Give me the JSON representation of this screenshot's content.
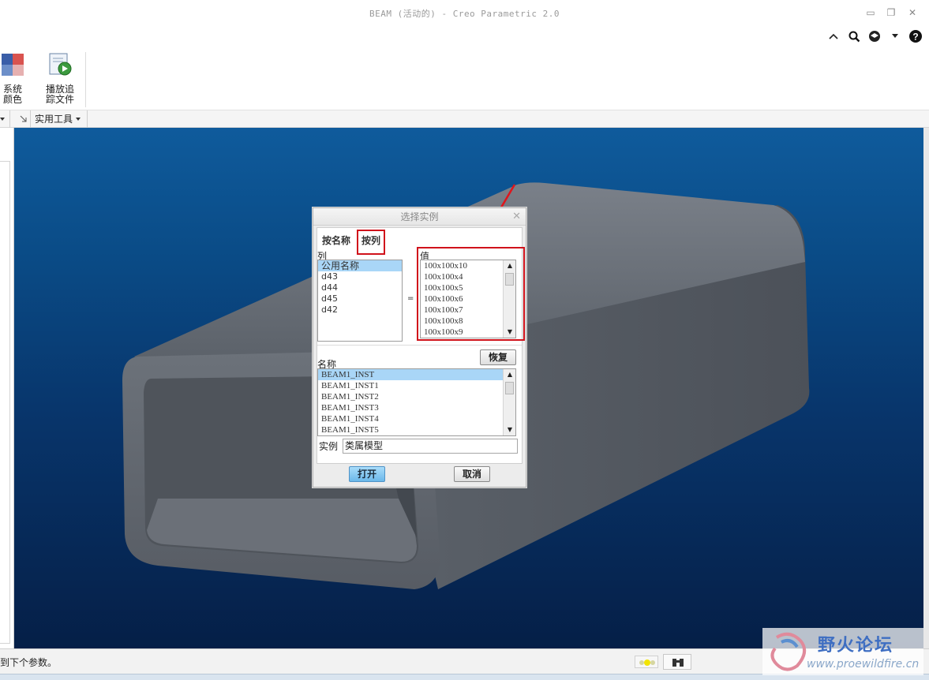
{
  "window": {
    "title": "BEAM (活动的) - Creo Parametric 2.0",
    "minimize": "▭",
    "restore": "❐",
    "close": "✕"
  },
  "quick_access": {
    "icons": [
      "collapse-ribbon-icon",
      "search-icon",
      "help-center-icon",
      "dropdown-icon",
      "help-icon"
    ]
  },
  "ribbon": {
    "buttons": [
      {
        "label": "系统\n颜色",
        "icon": "system-colors-icon"
      },
      {
        "label": "播放追\n踪文件",
        "icon": "play-trail-file-icon"
      }
    ],
    "group_label": "实用工具"
  },
  "dialog": {
    "title": "选择实例",
    "tabs": [
      {
        "label": "按名称"
      },
      {
        "label": "按列"
      }
    ],
    "columns_label": "列",
    "columns": [
      "公用名称",
      "d43",
      "d44",
      "d45",
      "d42"
    ],
    "equals": "=",
    "values_label": "值",
    "values": [
      "100x100x10",
      "100x100x4",
      "100x100x5",
      "100x100x6",
      "100x100x7",
      "100x100x8",
      "100x100x9"
    ],
    "restore_label": "恢复",
    "names_label": "名称",
    "names": [
      "BEAM1_INST",
      "BEAM1_INST1",
      "BEAM1_INST2",
      "BEAM1_INST3",
      "BEAM1_INST4",
      "BEAM1_INST5"
    ],
    "instance_label": "实例",
    "instance_value": "类属模型",
    "open_label": "打开",
    "cancel_label": "取消"
  },
  "status": {
    "message": "到下个参数。"
  },
  "watermark": {
    "title": "野火论坛",
    "url": "www.proewildfire.cn"
  },
  "colors": {
    "highlight_red": "#d0121b",
    "selection_blue": "#a9d6f7",
    "viewport_top": "#0f5b9c",
    "viewport_bottom": "#051f47",
    "beam_gray": "#5f656d"
  }
}
